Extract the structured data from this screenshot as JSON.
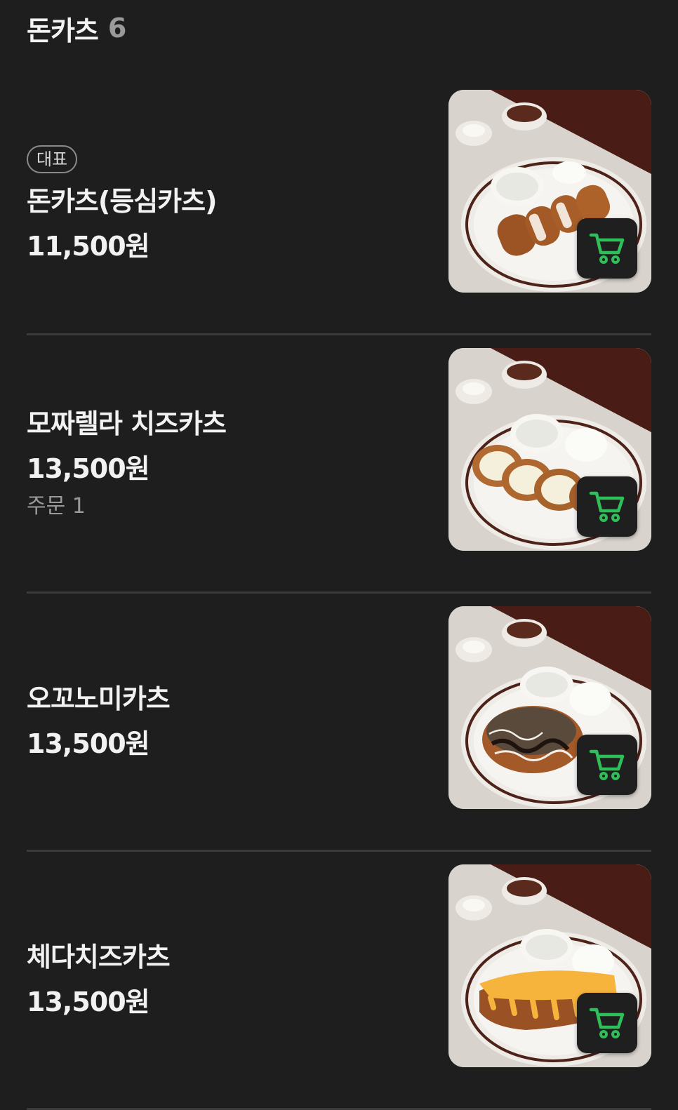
{
  "section": {
    "title": "돈카츠",
    "count": "6"
  },
  "items": [
    {
      "badge": "대표",
      "name": "돈카츠(등심카츠)",
      "price": "11,500원",
      "orders": null,
      "dish": "sliced-pork-cutlet"
    },
    {
      "badge": null,
      "name": "모짜렐라 치즈카츠",
      "price": "13,500원",
      "orders": "주문 1",
      "dish": "mozzarella-cheese-cutlet"
    },
    {
      "badge": null,
      "name": "오꼬노미카츠",
      "price": "13,500원",
      "orders": null,
      "dish": "okonomi-cutlet"
    },
    {
      "badge": null,
      "name": "체다치즈카츠",
      "price": "13,500원",
      "orders": null,
      "dish": "cheddar-cheese-cutlet"
    }
  ],
  "colors": {
    "background": "#1e1e1e",
    "divider": "#3a3a3a",
    "cart_icon": "#2fbf58",
    "cart_button_bg": "#1f1f1f"
  },
  "icons": {
    "cart": "cart-icon"
  }
}
